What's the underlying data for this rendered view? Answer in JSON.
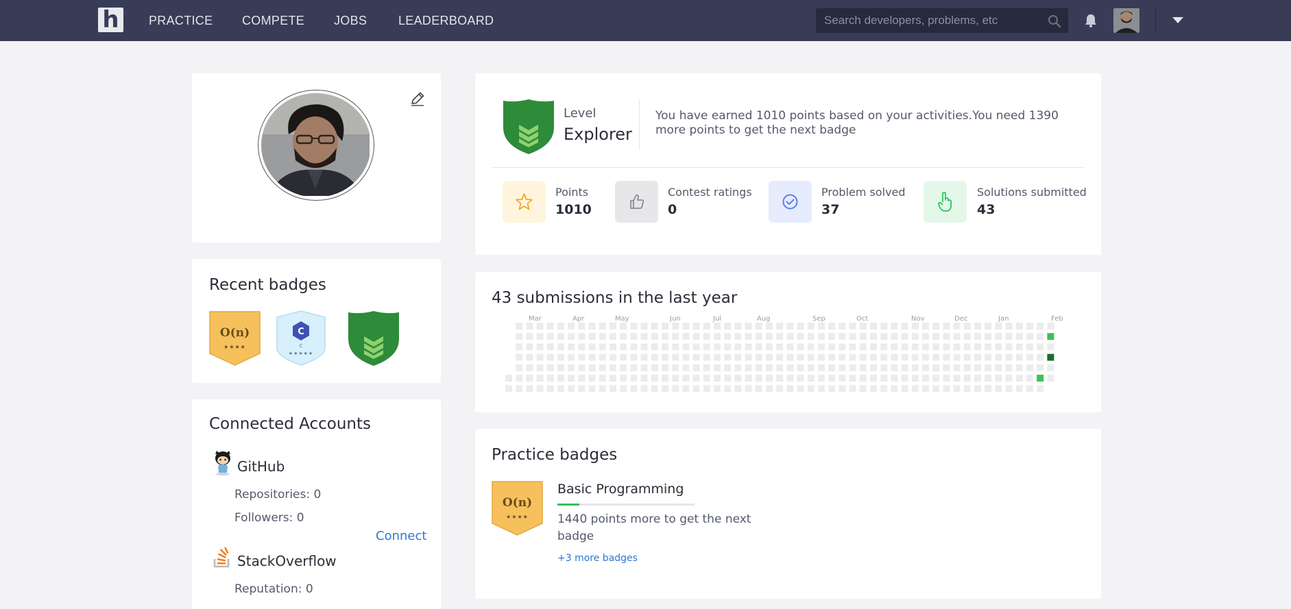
{
  "nav": {
    "logo_letter": "h",
    "links": [
      "PRACTICE",
      "COMPETE",
      "JOBS",
      "LEADERBOARD"
    ],
    "search_placeholder": "Search developers, problems, etc",
    "icons": [
      "search-icon",
      "bell-icon",
      "avatar",
      "chevron-down-icon"
    ]
  },
  "badges_card": {
    "title": "Recent badges",
    "badges": [
      {
        "icon": "o-n-badge-icon",
        "text": "O(n)",
        "stars": "★★★★"
      },
      {
        "icon": "c-badge-icon",
        "text": "C",
        "sub": "C",
        "stars": "★★★★★"
      },
      {
        "icon": "explorer-shield-icon"
      }
    ]
  },
  "accounts": {
    "title": "Connected Accounts",
    "github": {
      "name": "GitHub",
      "repos": "Repositories: 0",
      "followers": "Followers: 0",
      "connect": "Connect"
    },
    "stackoverflow": {
      "name": "StackOverflow",
      "reputation": "Reputation: 0"
    }
  },
  "level": {
    "label": "Level",
    "name": "Explorer",
    "message": "You have earned 1010 points based on your activities.You need 1390 more points to get the next badge",
    "stats": [
      {
        "label": "Points",
        "value": "1010",
        "icon": "star-icon",
        "bg": "#fff5dc",
        "color": "#f4a52a"
      },
      {
        "label": "Contest ratings",
        "value": "0",
        "icon": "thumbs-up-icon",
        "bg": "#e7e7e9",
        "color": "#8a8d96"
      },
      {
        "label": "Problem solved",
        "value": "37",
        "icon": "check-circle-icon",
        "bg": "#e6ecfd",
        "color": "#5b7fe8"
      },
      {
        "label": "Solutions submitted",
        "value": "43",
        "icon": "hand-pointer-icon",
        "bg": "#e4f8ea",
        "color": "#2fc15d"
      }
    ]
  },
  "activity": {
    "title": "43 submissions in the last year",
    "months": [
      "Mar",
      "Apr",
      "May",
      "Jun",
      "Jul",
      "Aug",
      "Sep",
      "Oct",
      "Nov",
      "Dec",
      "Jan",
      "Feb"
    ],
    "colors": {
      "empty": "#ececec",
      "low": "#3cc154",
      "high": "#1e6b2d"
    },
    "active_cells": [
      {
        "week": 52,
        "day": 1,
        "level": "low"
      },
      {
        "week": 52,
        "day": 3,
        "level": "high"
      },
      {
        "week": 51,
        "day": 5,
        "level": "low"
      }
    ]
  },
  "practice": {
    "title": "Practice badges",
    "badge_text": "O(n)",
    "badge_stars": "★★★★",
    "name": "Basic Programming",
    "progress": 0.16,
    "desc": "1440 points more to get the next badge",
    "more": "+3 more badges"
  }
}
